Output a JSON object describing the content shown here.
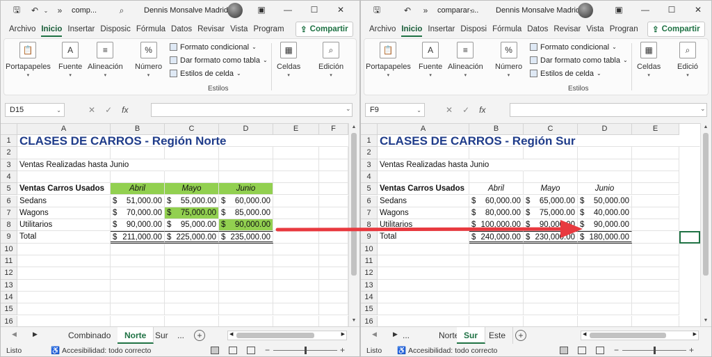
{
  "left": {
    "title_file": "comp...",
    "user": "Dennis Monsalve Madrid",
    "menu": [
      "Archivo",
      "Inicio",
      "Insertar",
      "Disposic",
      "Fórmula",
      "Datos",
      "Revisar",
      "Vista",
      "Program"
    ],
    "share": "Compartir",
    "ribbon": {
      "portapapeles": "Portapapeles",
      "fuente": "Fuente",
      "alineacion": "Alineación",
      "numero": "Número",
      "formato_condicional": "Formato condicional",
      "dar_formato": "Dar formato como tabla",
      "estilos_celda": "Estilos de celda",
      "estilos": "Estilos",
      "celdas": "Celdas",
      "edicion": "Edición"
    },
    "namebox": "D15",
    "columns": [
      "A",
      "B",
      "C",
      "D",
      "E",
      "F"
    ],
    "rows": [
      "1",
      "2",
      "3",
      "4",
      "5",
      "6",
      "7",
      "8",
      "9",
      "10",
      "11",
      "12",
      "13",
      "14",
      "15",
      "16"
    ],
    "sheet_title": "CLASES DE CARROS - Región Norte",
    "subtitle": "Ventas Realizadas hasta Junio",
    "header_label": "Ventas Carros Usados",
    "months": [
      "Abril",
      "Mayo",
      "Junio"
    ],
    "currency": "$",
    "rowlabels": [
      "Sedans",
      "Wagons",
      "Utilitarios",
      "Total"
    ],
    "values": [
      [
        "51,000.00",
        "55,000.00",
        "60,000.00"
      ],
      [
        "70,000.00",
        "75,000.00",
        "85,000.00"
      ],
      [
        "90,000.00",
        "95,000.00",
        "90,000.00"
      ],
      [
        "211,000.00",
        "225,000.00",
        "235,000.00"
      ]
    ],
    "tabs": [
      "Combinado",
      "Norte",
      "Sur",
      "..."
    ],
    "status": "Listo",
    "accessibility": "Accesibilidad: todo correcto"
  },
  "right": {
    "title_file": "comparar-...",
    "user": "Dennis Monsalve Madrid",
    "menu": [
      "Archivo",
      "Inicio",
      "Insertar",
      "Disposi",
      "Fórmula",
      "Datos",
      "Revisar",
      "Vista",
      "Progran"
    ],
    "share": "Compartir",
    "ribbon": {
      "portapapeles": "Portapapeles",
      "fuente": "Fuente",
      "alineacion": "Alineación",
      "numero": "Número",
      "formato_condicional": "Formato condicional",
      "dar_formato": "Dar formato como tabla",
      "estilos_celda": "Estilos de celda",
      "estilos": "Estilos",
      "celdas": "Celdas",
      "edicion": "Edició"
    },
    "namebox": "F9",
    "columns": [
      "A",
      "B",
      "C",
      "D",
      "E"
    ],
    "rows": [
      "1",
      "2",
      "3",
      "4",
      "5",
      "6",
      "7",
      "8",
      "9",
      "10",
      "11",
      "12",
      "13",
      "14",
      "15",
      "16"
    ],
    "sheet_title": "CLASES DE CARROS - Región Sur",
    "subtitle": "Ventas Realizadas hasta Junio",
    "header_label": "Ventas Carros Usados",
    "months": [
      "Abril",
      "Mayo",
      "Junio"
    ],
    "currency": "$",
    "rowlabels": [
      "Sedans",
      "Wagons",
      "Utilitarios",
      "Total"
    ],
    "values": [
      [
        "60,000.00",
        "65,000.00",
        "50,000.00"
      ],
      [
        "80,000.00",
        "75,000.00",
        "40,000.00"
      ],
      [
        "100,000.00",
        "90,000.00",
        "90,000.00"
      ],
      [
        "240,000.00",
        "230,000.00",
        "180,000.00"
      ]
    ],
    "tabs": [
      "...",
      "Norte",
      "Sur",
      "Este"
    ],
    "status": "Listo",
    "accessibility": "Accesibilidad: todo correcto"
  },
  "colors": {
    "excel_green": "#1f7244",
    "highlight": "#92d050",
    "title_blue": "#1f3c8a",
    "arrow_red": "#e8393f"
  }
}
